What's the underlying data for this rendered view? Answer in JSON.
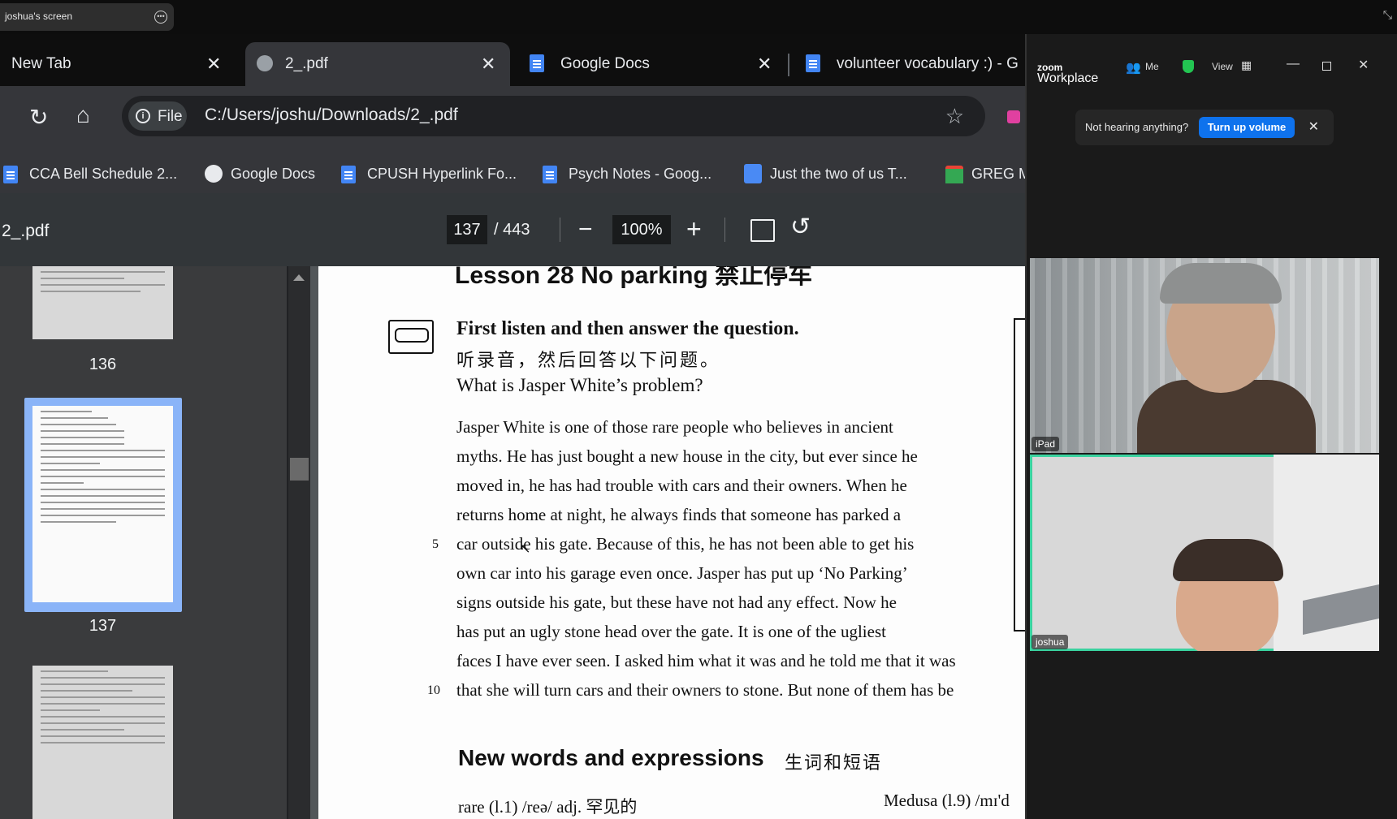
{
  "share_bar": {
    "label": "joshua's screen"
  },
  "browser": {
    "tabs": [
      {
        "title": "New Tab",
        "active": false
      },
      {
        "title": "2_.pdf",
        "active": true
      },
      {
        "title": "Google Docs",
        "active": false
      },
      {
        "title": "volunteer vocabulary :) - G",
        "active": false
      }
    ],
    "file_chip": "File",
    "url": "C:/Users/joshu/Downloads/2_.pdf",
    "bookmarks": [
      "CCA Bell Schedule 2...",
      "Google Docs",
      "CPUSH Hyperlink Fo...",
      "Psych Notes - Goog...",
      "Just the two of us T...",
      "GREG M"
    ]
  },
  "pdf": {
    "title": "2_.pdf",
    "page_current": "137",
    "page_total": "/ 443",
    "zoom": "100%",
    "thumbnails": [
      "136",
      "137"
    ],
    "selected_page": "137",
    "content": {
      "lesson_heading": "Lesson 28   No parking   禁止停车",
      "instruction_en": "First listen and then answer the question.",
      "instruction_zh": "听录音，然后回答以下问题。",
      "question": "What is Jasper White’s problem?",
      "passage_lines": [
        "Jasper White is one of those rare people who believes in ancient",
        "myths. He has just bought a new house in the city, but ever since he",
        "moved in, he has had trouble with cars and their owners. When he",
        "returns home at night, he always finds that someone has parked a",
        "car outside his gate. Because of this, he has not been able to get his",
        "own car into his garage even once. Jasper has put up ‘No Parking’",
        "signs outside his gate, but these have not had any effect. Now he",
        "has put an ugly stone head over the gate. It is one of the ugliest",
        "faces I have ever seen. I asked him what it was and he told me that it was",
        "that she will turn cars and their owners to stone. But none of them has be"
      ],
      "line_numbers": [
        "5",
        "10"
      ],
      "section_title": "New words and expressions",
      "section_title_zh": "生词和短语",
      "vocab_left": "rare (l.1) /reə/ adj. 罕见的",
      "vocab_right": "Medusa (l.9) /mɪ'd"
    }
  },
  "zoom_app": {
    "logo_top": "zoom",
    "logo_bottom": "Workplace",
    "menu_me": "Me",
    "menu_view": "View",
    "notice_text": "Not hearing anything?",
    "notice_button": "Turn up volume",
    "participants": [
      {
        "name": "iPad"
      },
      {
        "name": "joshua",
        "active_speaker": true
      }
    ]
  },
  "colors": {
    "chrome_dark": "#202124",
    "pdf_toolbar": "#323639",
    "zoom_blue": "#0e72ed",
    "speaker_border": "#3ad29f"
  }
}
